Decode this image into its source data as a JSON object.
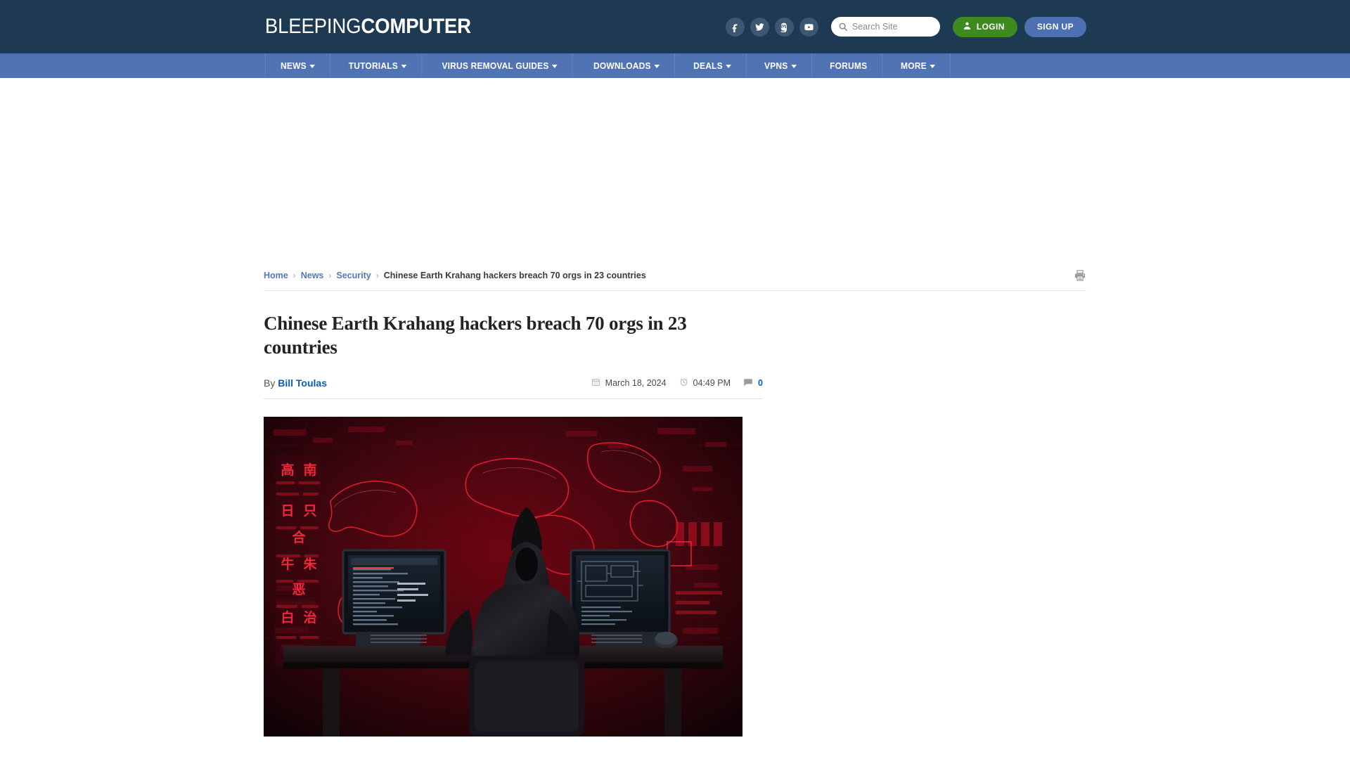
{
  "site": {
    "logo_thin": "BLEEPING",
    "logo_bold": "COMPUTER"
  },
  "header": {
    "social": [
      {
        "name": "facebook-icon",
        "label": "Facebook"
      },
      {
        "name": "twitter-icon",
        "label": "Twitter"
      },
      {
        "name": "mastodon-icon",
        "label": "Mastodon"
      },
      {
        "name": "youtube-icon",
        "label": "YouTube"
      }
    ],
    "search": {
      "placeholder": "Search Site",
      "value": ""
    },
    "login_label": "LOGIN",
    "signup_label": "SIGN UP",
    "colors": {
      "header_bg": "#1e3a52",
      "nav_bg": "#5073b4",
      "login_green": "#3d8b1f",
      "signup_blue": "#4d70b3",
      "link_blue": "#0b5cab"
    }
  },
  "nav": {
    "items": [
      {
        "label": "NEWS",
        "has_dropdown": true
      },
      {
        "label": "TUTORIALS",
        "has_dropdown": true
      },
      {
        "label": "VIRUS REMOVAL GUIDES",
        "has_dropdown": true
      },
      {
        "label": "DOWNLOADS",
        "has_dropdown": true
      },
      {
        "label": "DEALS",
        "has_dropdown": true
      },
      {
        "label": "VPNS",
        "has_dropdown": true
      },
      {
        "label": "FORUMS",
        "has_dropdown": false
      },
      {
        "label": "MORE",
        "has_dropdown": true
      }
    ]
  },
  "breadcrumb": {
    "items": [
      {
        "label": "Home",
        "link": true
      },
      {
        "label": "News",
        "link": true
      },
      {
        "label": "Security",
        "link": true
      },
      {
        "label": "Chinese Earth Krahang hackers breach 70 orgs in 23 countries",
        "link": false
      }
    ],
    "separator": "›"
  },
  "article": {
    "title": "Chinese Earth Krahang hackers breach 70 orgs in 23 countries",
    "by_prefix": "By",
    "author": "Bill Toulas",
    "date": "March 18, 2024",
    "time": "04:49 PM",
    "comment_count": "0",
    "hero_alt": "Hooded hacker seated at a desk between two monitors in front of a glowing red world map and Chinese characters"
  },
  "toolbar": {
    "print_label": "Print"
  }
}
